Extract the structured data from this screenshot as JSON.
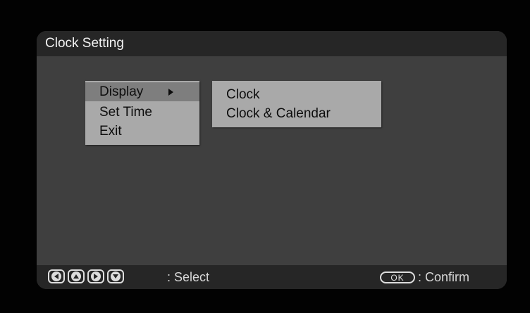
{
  "window": {
    "title": "Clock Setting"
  },
  "main_menu": {
    "items": [
      {
        "label": "Display",
        "selected": true,
        "has_submenu": true
      },
      {
        "label": "Set Time",
        "selected": false
      },
      {
        "label": "Exit",
        "selected": false
      }
    ]
  },
  "sub_menu": {
    "items": [
      {
        "label": "Clock"
      },
      {
        "label": "Clock & Calendar"
      }
    ]
  },
  "footer": {
    "nav_icons": [
      "arrow-left-icon",
      "arrow-up-icon",
      "arrow-right-icon",
      "arrow-down-icon"
    ],
    "select_label": ": Select",
    "ok_key_label": "OK",
    "confirm_label": ": Confirm"
  },
  "colors": {
    "background": "#020202",
    "panel": "#3f3f3f",
    "bars": "#262626",
    "menu": "#a9a9a9",
    "menu_selected": "#7e7e7e"
  }
}
